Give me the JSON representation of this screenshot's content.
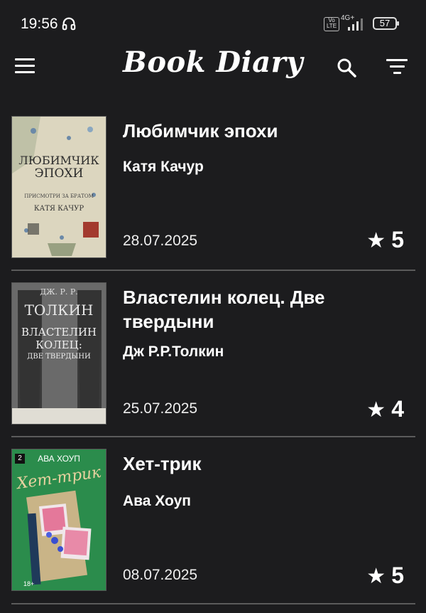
{
  "status_bar": {
    "time": "19:56",
    "network": "4G+",
    "volte": "Vo LTE",
    "battery": "57"
  },
  "app_bar": {
    "title": "Book Diary"
  },
  "books": [
    {
      "title": "Любимчик эпохи",
      "author": "Катя Качур",
      "date": "28.07.2025",
      "rating": "5",
      "cover": {
        "line1": "ЛЮБИМЧИК",
        "line2": "ЭПОХИ",
        "subtitle": "ПРИСМОТРИ ЗА БРАТОМ",
        "author": "КАТЯ КАЧУР",
        "bg": "#ddd8c4"
      }
    },
    {
      "title": "Властелин колец. Две твердыни",
      "author": "Дж Р.Р.Толкин",
      "date": "25.07.2025",
      "rating": "4",
      "cover": {
        "author1": "ДЖ. Р. Р.",
        "author2": "ТОЛКИН",
        "line1": "ВЛАСТЕЛИН",
        "line2": "КОЛЕЦ:",
        "line3": "ДВЕ ТВЕРДЫНИ",
        "bg": "#5d5d5d"
      }
    },
    {
      "title": "Хет-трик",
      "author": "Ава Хоуп",
      "date": "08.07.2025",
      "rating": "5",
      "cover": {
        "number": "2",
        "author": "АВА ХОУП",
        "title": "Хет-трик",
        "age": "18+",
        "bg": "#2a8a4a"
      }
    }
  ]
}
